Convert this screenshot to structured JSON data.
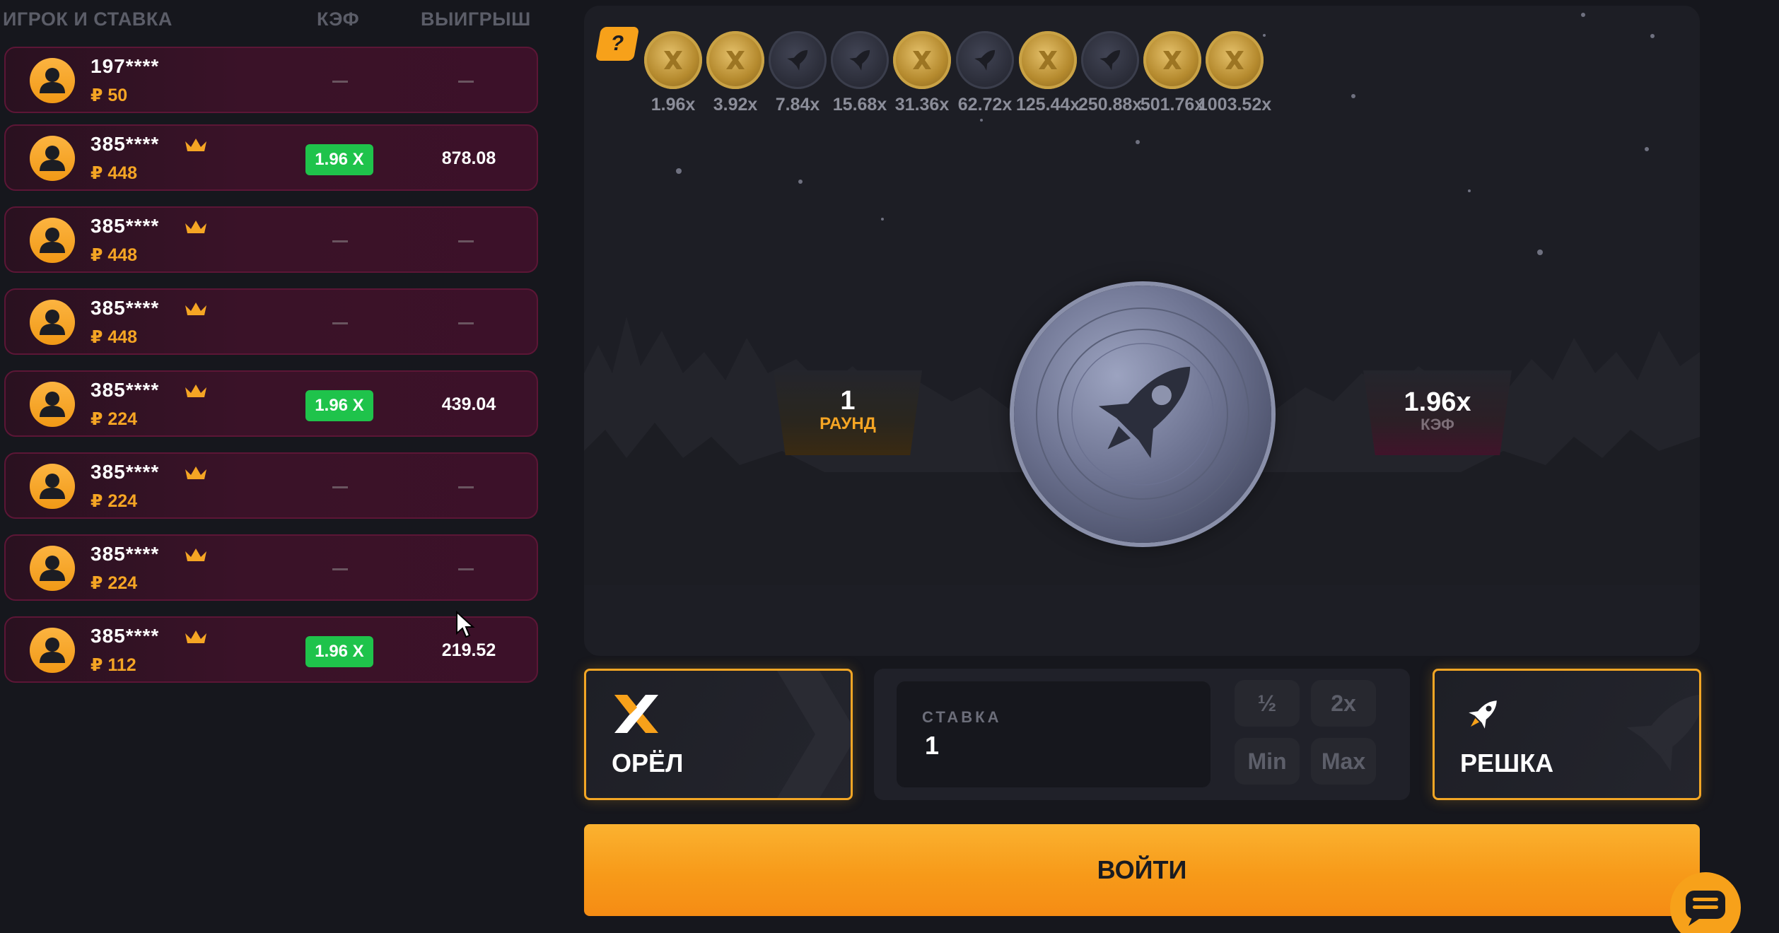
{
  "players": {
    "headers": {
      "player": "ИГРОК И СТАВКА",
      "coef": "КЭФ",
      "win": "ВЫИГРЫШ"
    },
    "rows": [
      {
        "name": "197****",
        "bet": "₽ 50",
        "vip": false,
        "coef": "",
        "win": ""
      },
      {
        "name": "385****",
        "bet": "₽ 448",
        "vip": true,
        "coef": "1.96 X",
        "win": "878.08"
      },
      {
        "name": "385****",
        "bet": "₽ 448",
        "vip": true,
        "coef": "",
        "win": ""
      },
      {
        "name": "385****",
        "bet": "₽ 448",
        "vip": true,
        "coef": "",
        "win": ""
      },
      {
        "name": "385****",
        "bet": "₽ 224",
        "vip": true,
        "coef": "1.96 X",
        "win": "439.04"
      },
      {
        "name": "385****",
        "bet": "₽ 224",
        "vip": true,
        "coef": "",
        "win": ""
      },
      {
        "name": "385****",
        "bet": "₽ 224",
        "vip": true,
        "coef": "",
        "win": ""
      },
      {
        "name": "385****",
        "bet": "₽ 112",
        "vip": true,
        "coef": "1.96 X",
        "win": "219.52"
      }
    ]
  },
  "game": {
    "help_label": "?",
    "history": [
      {
        "side": "gold",
        "mult": "1.96x"
      },
      {
        "side": "gold",
        "mult": "3.92x"
      },
      {
        "side": "dark",
        "mult": "7.84x"
      },
      {
        "side": "dark",
        "mult": "15.68x"
      },
      {
        "side": "gold",
        "mult": "31.36x"
      },
      {
        "side": "dark",
        "mult": "62.72x"
      },
      {
        "side": "gold",
        "mult": "125.44x"
      },
      {
        "side": "dark",
        "mult": "250.88x"
      },
      {
        "side": "gold",
        "mult": "501.76x"
      },
      {
        "side": "gold",
        "mult": "1003.52x"
      }
    ],
    "round": {
      "value": "1",
      "label": "РАУНД"
    },
    "coef": {
      "value": "1.96x",
      "label": "КЭФ"
    },
    "coin_icon": "rocket-icon"
  },
  "controls": {
    "heads_label": "ОРЁЛ",
    "tails_label": "РЕШКА",
    "bet_caption": "СТАВКА",
    "bet_value": "1",
    "half": "½",
    "double": "2x",
    "min": "Min",
    "max": "Max",
    "enter": "ВОЙТИ"
  },
  "colors": {
    "accent": "#f7a11a",
    "win_badge": "#1fc34b",
    "row_bg": "#3a1228"
  }
}
